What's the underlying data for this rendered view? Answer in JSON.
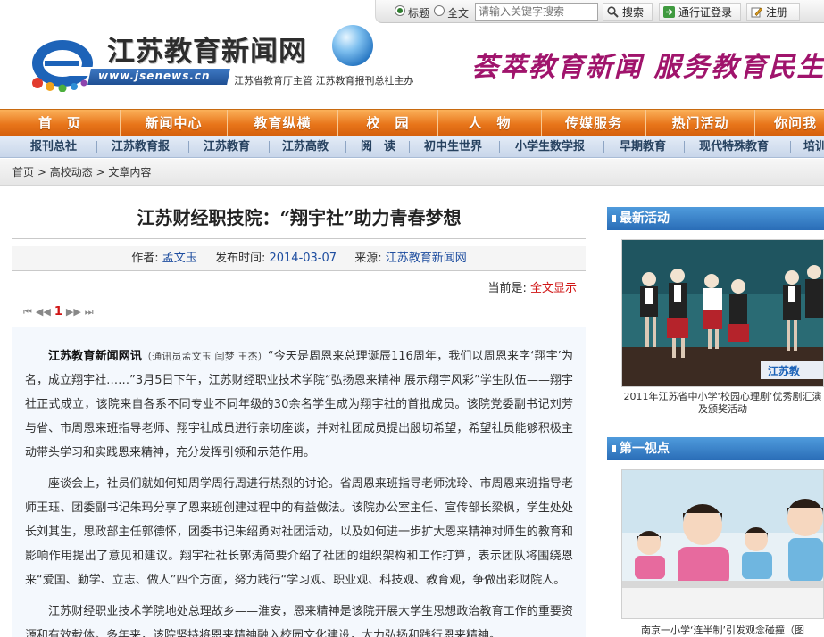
{
  "topbar": {
    "radio_title": "标题",
    "radio_fulltext": "全文",
    "search_placeholder": "请输入关键字搜索",
    "search_button": "搜索",
    "login_button": "通行证登录",
    "register_button": "注册"
  },
  "header": {
    "site_name": "江苏教育新闻网",
    "url": "www.jsenews.cn",
    "sponsor": "江苏省教育厅主管 江苏教育报刊总社主办",
    "slogan": "荟萃教育新闻  服务教育民生"
  },
  "main_nav": [
    "首　页",
    "新闻中心",
    "教育纵横",
    "校　园",
    "人　物",
    "传媒服务",
    "热门活动",
    "你问我"
  ],
  "sub_nav": [
    "报刊总社",
    "江苏教育报",
    "江苏教育",
    "江苏高教",
    "阅　读",
    "初中生世界",
    "小学生数学报",
    "早期教育",
    "现代特殊教育",
    "培训"
  ],
  "breadcrumb": [
    "首页",
    "> 高校动态",
    "> 文章内容"
  ],
  "article": {
    "title": "江苏财经职技院：“翔宇社”助力青春梦想",
    "author_label": "作者:",
    "author": "孟文玉",
    "date_label": "发布时间:",
    "date": "2014-03-07",
    "source_label": "来源:",
    "source": "江苏教育新闻网",
    "current_label": "当前是:",
    "current_value": "全文显示",
    "pager_first": "⏮",
    "pager_prev": "◀◀",
    "pager_current": "1",
    "pager_next": "▶▶",
    "pager_last": "⏭",
    "lead": "江苏教育新闻网讯",
    "byline": "（通讯员孟文玉 闫梦 王杰）",
    "p1_rest": "“今天是周恩来总理诞辰116周年，我们以周恩来字‘翔宇’为名，成立翔宇社……”3月5日下午，江苏财经职业技术学院“弘扬恩来精神 展示翔宇风彩”学生队伍——翔宇社正式成立，该院来自各系不同专业不同年级的30余名学生成为翔宇社的首批成员。该院党委副书记刘芳与省、市周恩来班指导老师、翔宇社成员进行亲切座谈，并对社团成员提出殷切希望，希望社员能够积极主动带头学习和实践恩来精神，充分发挥引领和示范作用。",
    "p2": "座谈会上，社员们就如何知周学周行周进行热烈的讨论。省周恩来班指导老师沈玲、市周恩来班指导老师王珏、团委副书记朱玛分享了恩来班创建过程中的有益做法。该院办公室主任、宣传部长梁枫，学生处处长刘其生，思政部主任郭德怀，团委书记朱绍勇对社团活动，以及如何进一步扩大恩来精神对师生的教育和影响作用提出了意见和建议。翔宇社社长郭涛简要介绍了社团的组织架构和工作打算，表示团队将围绕恩来“爱国、勤学、立志、做人”四个方面，努力践行“学习观、职业观、科技观、教育观，争做出彩财院人。",
    "p3": "江苏财经职业技术学院地处总理故乡——淮安，恩来精神是该院开展大学生思想政治教育工作的重要资源和有效载体。多年来，该院坚持将恩来精神融入校园文化建设，大力弘扬和践行恩来精神。"
  },
  "sidebar": {
    "head1": "最新活动",
    "caption1": "2011年江苏省中小学‘校园心理剧’优秀剧汇演及颁奖活动",
    "watermark": "江苏教",
    "head2": "第一视点",
    "caption2": "南京一小学‘连半制’引发观念碰撞（图"
  },
  "colors": {
    "nav_orange": "#e8751a",
    "slogan_magenta": "#a0146c",
    "link_blue": "#1f4ea0",
    "alert_red": "#d01515",
    "sidebar_blue": "#2a6db7"
  }
}
